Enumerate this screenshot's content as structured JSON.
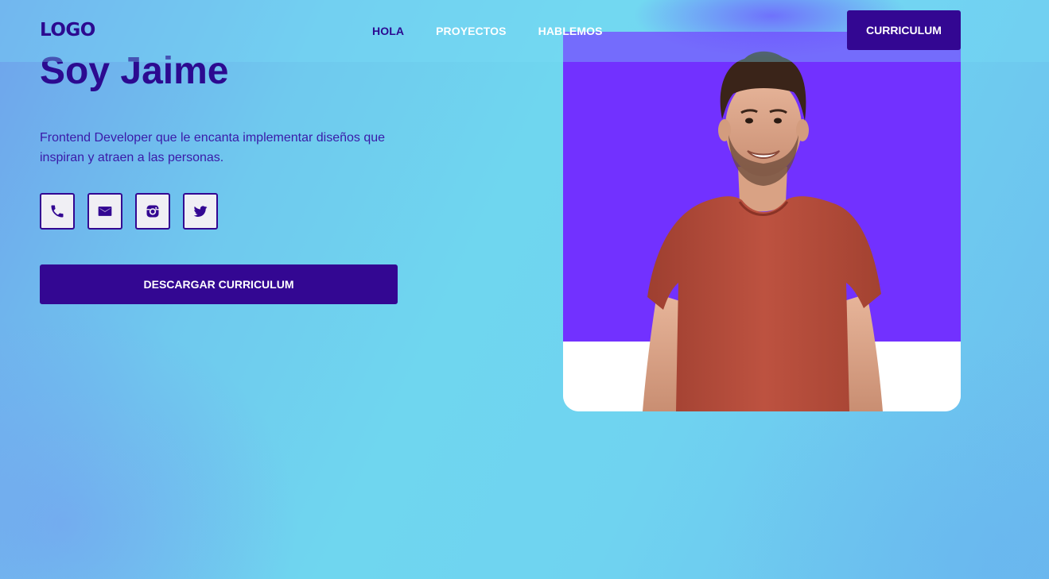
{
  "header": {
    "logo": "LOGO",
    "nav": [
      {
        "label": "HOLA",
        "active": true
      },
      {
        "label": "PROYECTOS",
        "active": false
      },
      {
        "label": "HABLEMOS",
        "active": false
      }
    ],
    "cta_label": "CURRICULUM"
  },
  "hero": {
    "title": "Soy Jaime",
    "description": "Frontend Developer que le encanta implementar diseños que inspiran y atraen a las personas.",
    "social": [
      {
        "icon": "phone-icon"
      },
      {
        "icon": "mail-icon"
      },
      {
        "icon": "instagram-icon"
      },
      {
        "icon": "twitter-icon"
      }
    ],
    "download_label": "DESCARGAR CURRICULUM"
  },
  "colors": {
    "primary": "#330792",
    "heading": "#2c0a90",
    "photo_bg": "#7231ff",
    "shirt": "#b44d3c"
  }
}
